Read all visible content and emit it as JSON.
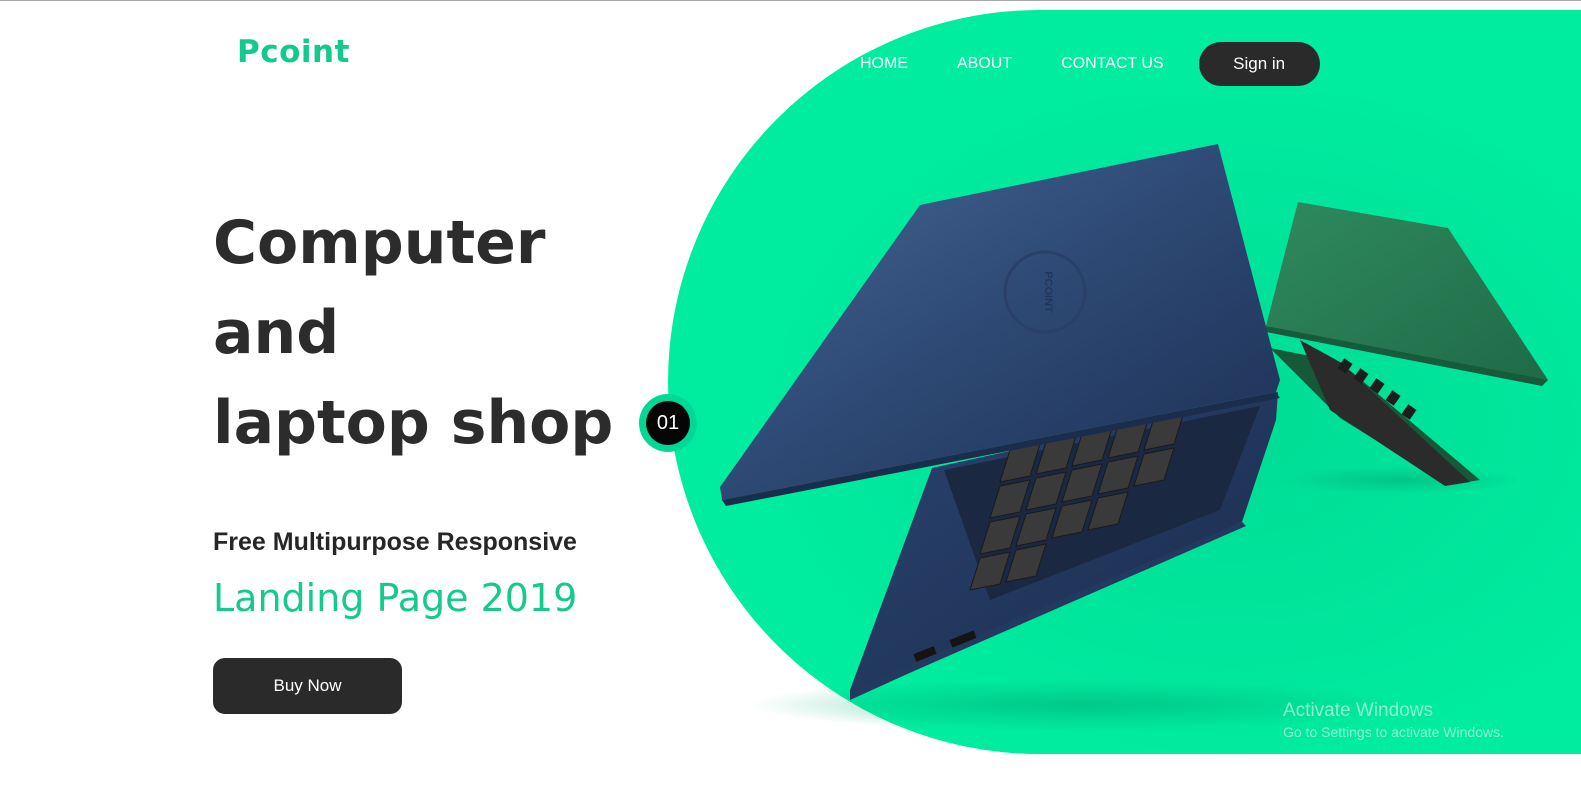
{
  "brand": {
    "logo_text": "Pcoint",
    "accent_color": "#13c98e",
    "hero_background_color": "#00ec9f",
    "dark_color": "#2a2a2b"
  },
  "nav": {
    "items": [
      {
        "label": "HOME"
      },
      {
        "label": "ABOUT"
      },
      {
        "label": "CONTACT US"
      }
    ],
    "signin_label": "Sign in"
  },
  "hero": {
    "headline_lines": [
      "Computer",
      "and",
      "laptop shop"
    ],
    "subline": "Free Multipurpose Responsive",
    "tagline": "Landing Page 2019",
    "cta_label": "Buy Now",
    "slide_number": "01",
    "laptop_brand_mark": "PCOINT"
  },
  "system_overlay": {
    "title": "Activate Windows",
    "subtitle": "Go to Settings to activate Windows."
  }
}
